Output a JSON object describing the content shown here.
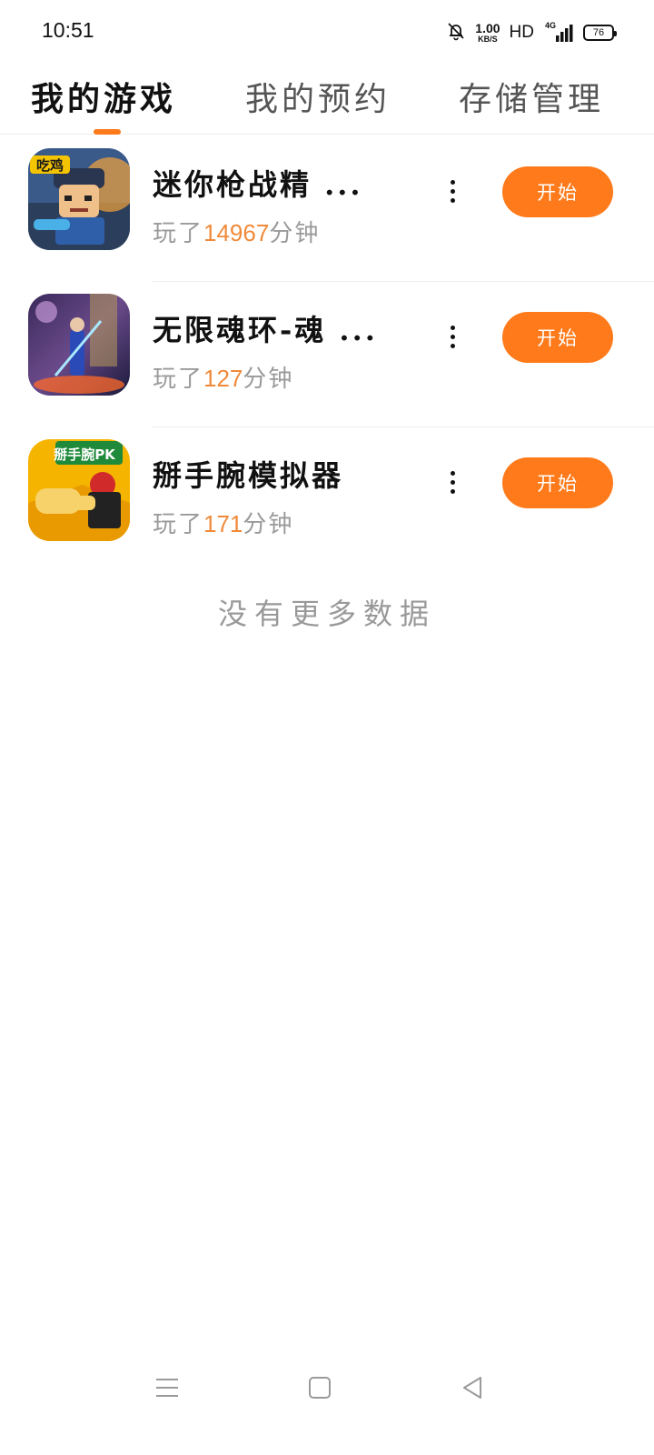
{
  "status_bar": {
    "time": "10:51",
    "net_speed_value": "1.00",
    "net_speed_unit": "KB/S",
    "hd": "HD",
    "network": "4G",
    "battery": "76",
    "icons": [
      "bell-off-icon",
      "signal-icon",
      "battery-icon"
    ]
  },
  "tabs": [
    {
      "label": "我的游戏",
      "active": true
    },
    {
      "label": "我的预约",
      "active": false
    },
    {
      "label": "存储管理",
      "active": false
    }
  ],
  "games": [
    {
      "name": "迷你枪战精 ...",
      "played_prefix": "玩了",
      "minutes": "14967",
      "played_suffix": "分钟",
      "button": "开始"
    },
    {
      "name": "无限魂环-魂 ...",
      "played_prefix": "玩了",
      "minutes": "127",
      "played_suffix": "分钟",
      "button": "开始"
    },
    {
      "name": "掰手腕模拟器",
      "played_prefix": "玩了",
      "minutes": "171",
      "played_suffix": "分钟",
      "button": "开始"
    }
  ],
  "game_icon_texts": [
    "吃鸡",
    "掰手腕PK"
  ],
  "list_end_text": "没有更多数据",
  "nav_bar": {
    "icons": [
      "menu-icon",
      "home-icon",
      "back-icon"
    ]
  },
  "colors": {
    "accent": "#FF7A1A",
    "minutes": "#F08A3A",
    "muted_text": "#9A9A9A"
  }
}
